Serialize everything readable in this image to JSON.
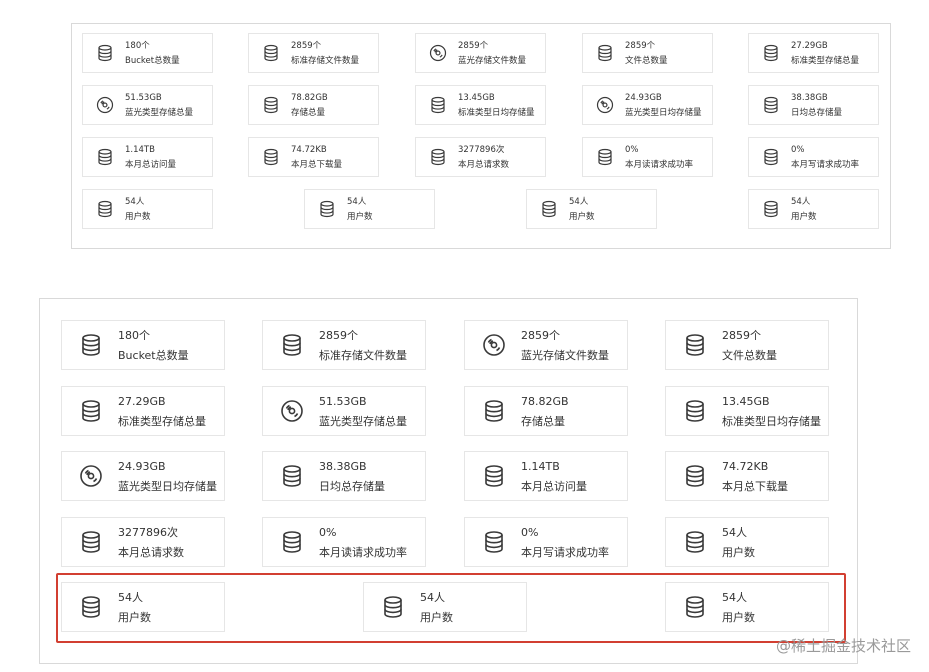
{
  "top_panel": {
    "cards": [
      {
        "value": "180个",
        "label": "Bucket总数量",
        "icon": "database-icon"
      },
      {
        "value": "2859个",
        "label": "标准存储文件数量",
        "icon": "database-icon"
      },
      {
        "value": "2859个",
        "label": "蓝光存储文件数量",
        "icon": "disc-icon"
      },
      {
        "value": "2859个",
        "label": "文件总数量",
        "icon": "database-icon"
      },
      {
        "value": "27.29GB",
        "label": "标准类型存储总量",
        "icon": "database-icon"
      },
      {
        "value": "51.53GB",
        "label": "蓝光类型存储总量",
        "icon": "disc-icon"
      },
      {
        "value": "78.82GB",
        "label": "存储总量",
        "icon": "database-icon"
      },
      {
        "value": "13.45GB",
        "label": "标准类型日均存储量",
        "icon": "database-icon"
      },
      {
        "value": "24.93GB",
        "label": "蓝光类型日均存储量",
        "icon": "disc-icon"
      },
      {
        "value": "38.38GB",
        "label": "日均总存储量",
        "icon": "database-icon"
      },
      {
        "value": "1.14TB",
        "label": "本月总访问量",
        "icon": "database-icon"
      },
      {
        "value": "74.72KB",
        "label": "本月总下载量",
        "icon": "database-icon"
      },
      {
        "value": "3277896次",
        "label": "本月总请求数",
        "icon": "database-icon"
      },
      {
        "value": "0%",
        "label": "本月读请求成功率",
        "icon": "database-icon"
      },
      {
        "value": "0%",
        "label": "本月写请求成功率",
        "icon": "database-icon"
      },
      {
        "value": "54人",
        "label": "用户数",
        "icon": "database-icon"
      },
      {
        "value": "54人",
        "label": "用户数",
        "icon": "database-icon"
      },
      {
        "value": "54人",
        "label": "用户数",
        "icon": "database-icon"
      },
      {
        "value": "54人",
        "label": "用户数",
        "icon": "database-icon"
      }
    ]
  },
  "bottom_panel": {
    "cards": [
      {
        "value": "180个",
        "label": "Bucket总数量",
        "icon": "database-icon"
      },
      {
        "value": "2859个",
        "label": "标准存储文件数量",
        "icon": "database-icon"
      },
      {
        "value": "2859个",
        "label": "蓝光存储文件数量",
        "icon": "disc-icon"
      },
      {
        "value": "2859个",
        "label": "文件总数量",
        "icon": "database-icon"
      },
      {
        "value": "27.29GB",
        "label": "标准类型存储总量",
        "icon": "database-icon"
      },
      {
        "value": "51.53GB",
        "label": "蓝光类型存储总量",
        "icon": "disc-icon"
      },
      {
        "value": "78.82GB",
        "label": "存储总量",
        "icon": "database-icon"
      },
      {
        "value": "13.45GB",
        "label": "标准类型日均存储量",
        "icon": "database-icon"
      },
      {
        "value": "24.93GB",
        "label": "蓝光类型日均存储量",
        "icon": "disc-icon"
      },
      {
        "value": "38.38GB",
        "label": "日均总存储量",
        "icon": "database-icon"
      },
      {
        "value": "1.14TB",
        "label": "本月总访问量",
        "icon": "database-icon"
      },
      {
        "value": "74.72KB",
        "label": "本月总下载量",
        "icon": "database-icon"
      },
      {
        "value": "3277896次",
        "label": "本月总请求数",
        "icon": "database-icon"
      },
      {
        "value": "0%",
        "label": "本月读请求成功率",
        "icon": "database-icon"
      },
      {
        "value": "0%",
        "label": "本月写请求成功率",
        "icon": "database-icon"
      },
      {
        "value": "54人",
        "label": "用户数",
        "icon": "database-icon"
      },
      {
        "value": "54人",
        "label": "用户数",
        "icon": "database-icon"
      },
      {
        "value": "54人",
        "label": "用户数",
        "icon": "database-icon"
      },
      {
        "value": "54人",
        "label": "用户数",
        "icon": "database-icon"
      }
    ],
    "highlight_color": "#d23f31"
  },
  "watermark": "@稀土掘金技术社区"
}
